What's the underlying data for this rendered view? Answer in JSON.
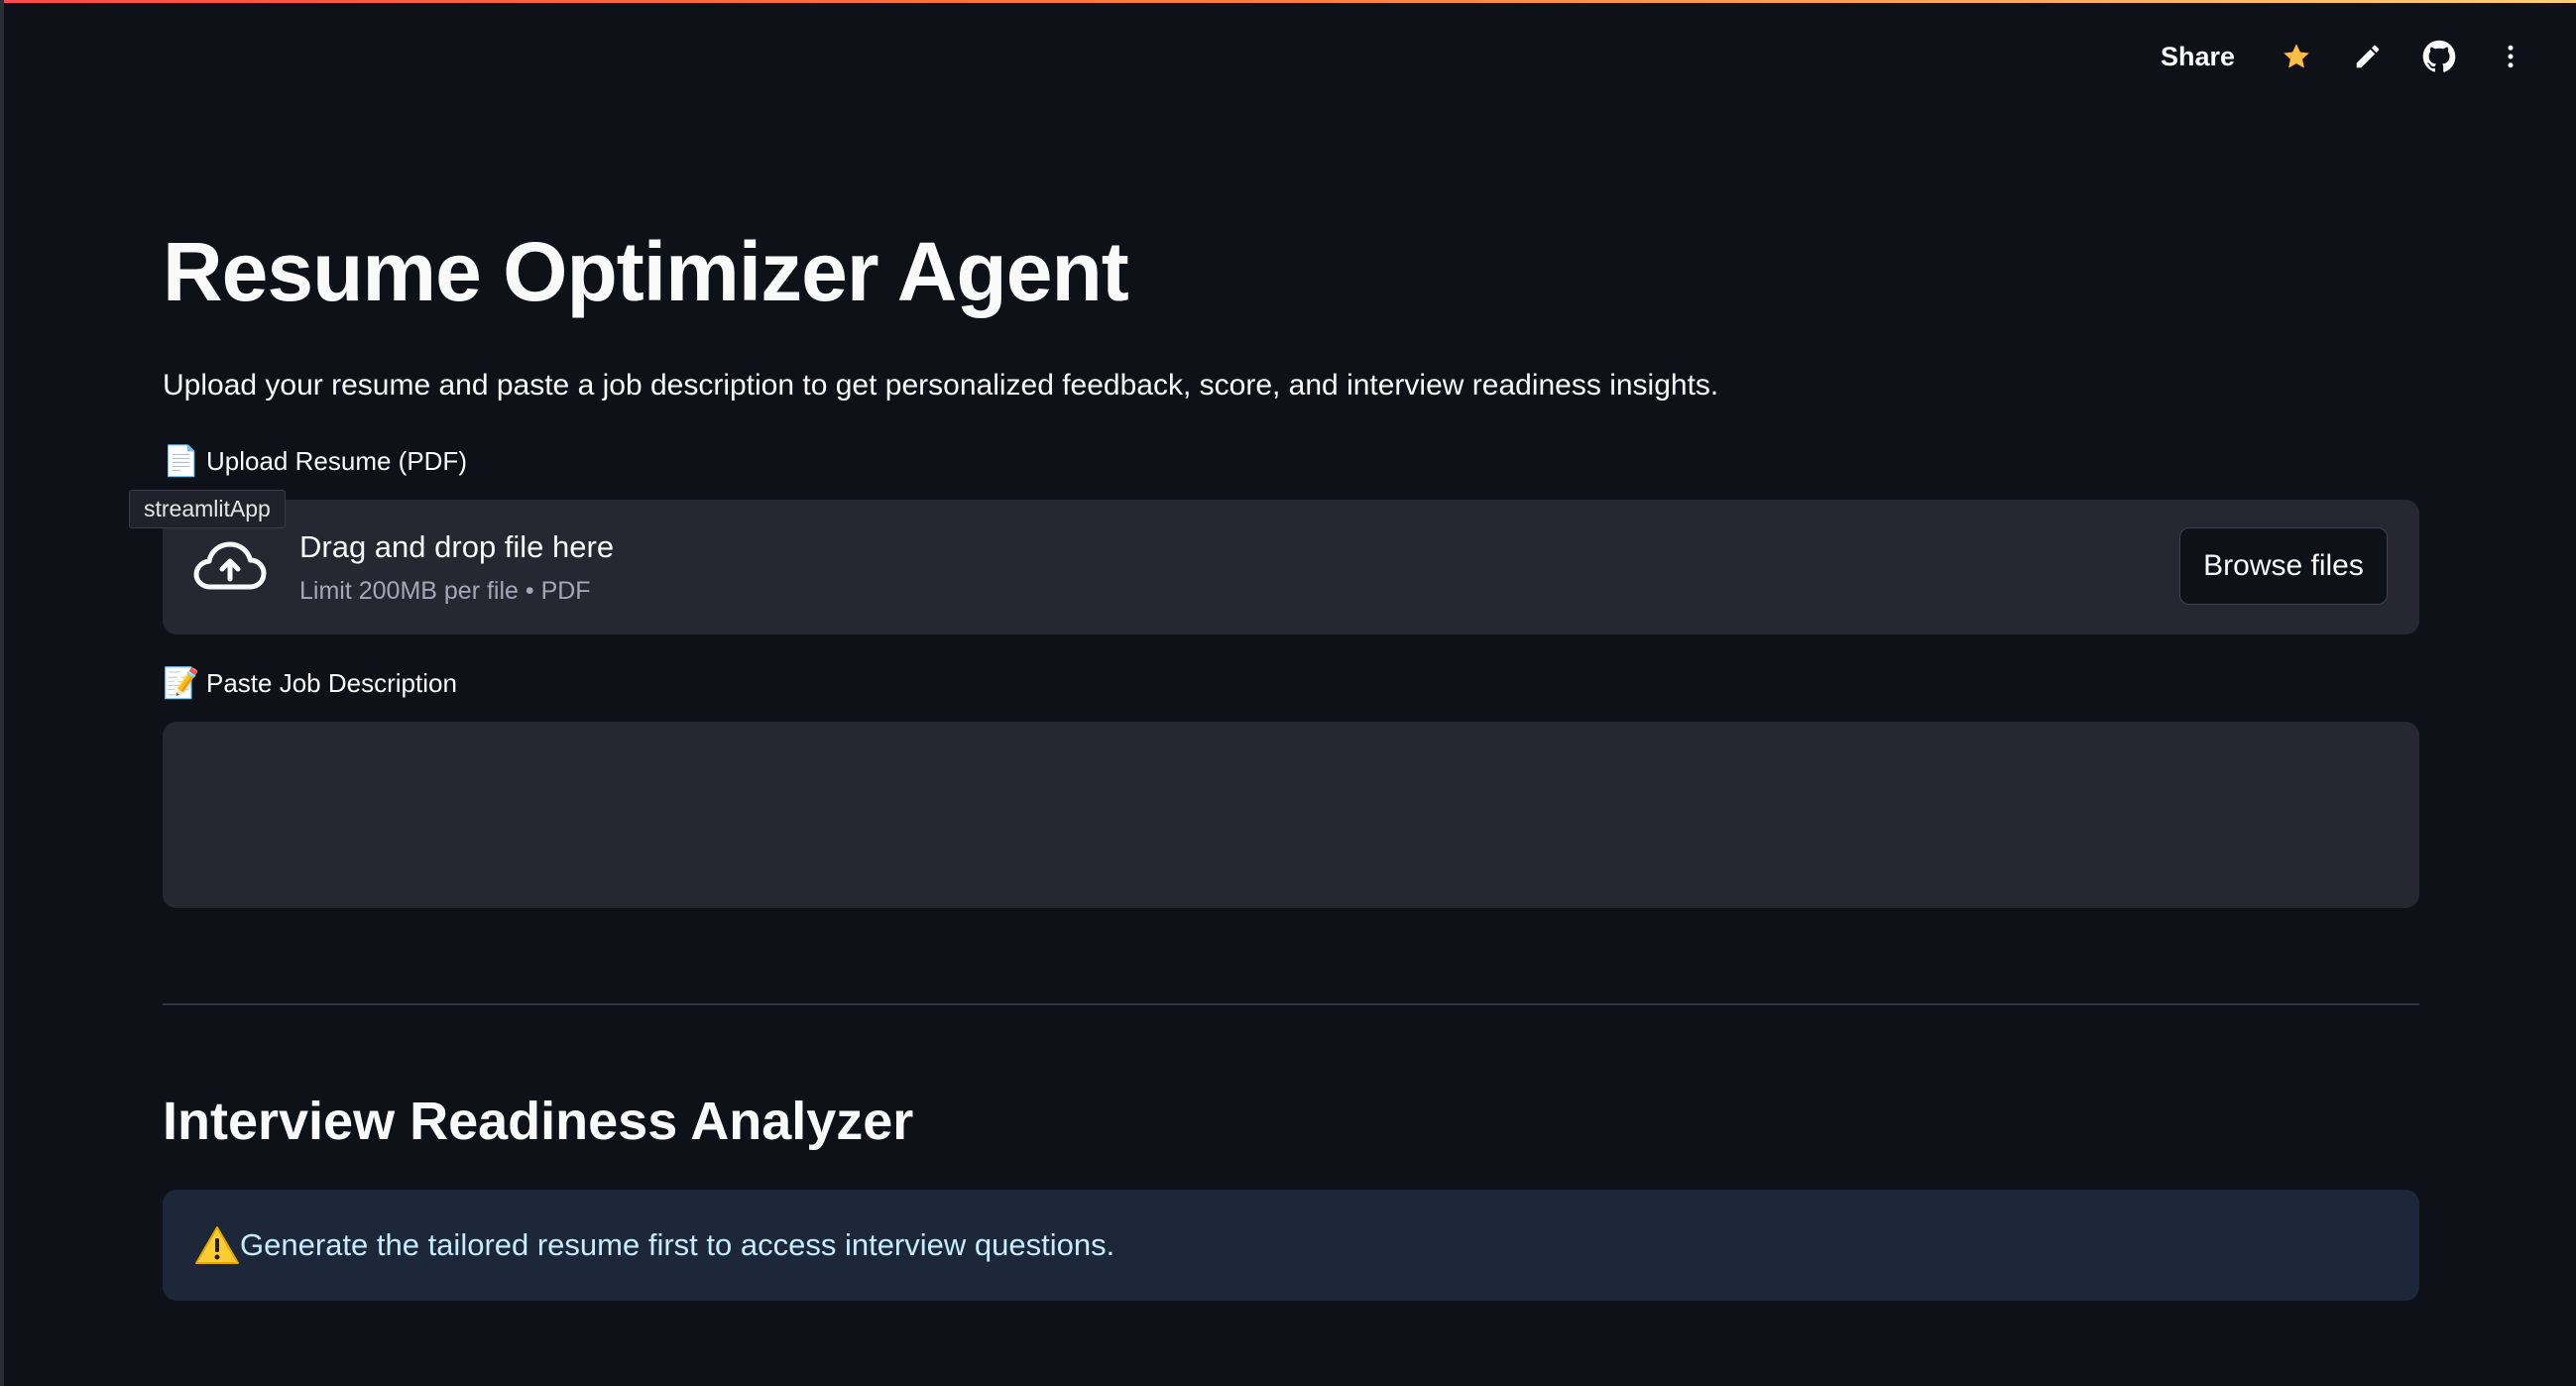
{
  "toolbar": {
    "share_label": "Share",
    "icons": [
      "star-icon",
      "pencil-icon",
      "github-icon",
      "more-vertical-icon"
    ],
    "star_color": "#ffbd45"
  },
  "main": {
    "title": "Resume Optimizer Agent",
    "subtitle": "Upload your resume and paste a job description to get personalized feedback, score, and interview readiness insights."
  },
  "upload": {
    "label": "Upload Resume (PDF)",
    "emoji": "📄",
    "tooltip": "streamlitApp",
    "drop_title": "Drag and drop file here",
    "limit_text": "Limit 200MB per file • PDF",
    "browse_label": "Browse files"
  },
  "job": {
    "label": "Paste Job Description",
    "emoji": "📝",
    "value": ""
  },
  "interview": {
    "title": "Interview Readiness Analyzer",
    "alert_text": "Generate the tailored resume first to access interview questions.",
    "alert_color": "#1c2839"
  },
  "colors": {
    "background": "#0e1117",
    "surface": "#262730",
    "accent_gradient": [
      "#ff4b4b",
      "#fd7e3a",
      "#ffd16a"
    ]
  }
}
